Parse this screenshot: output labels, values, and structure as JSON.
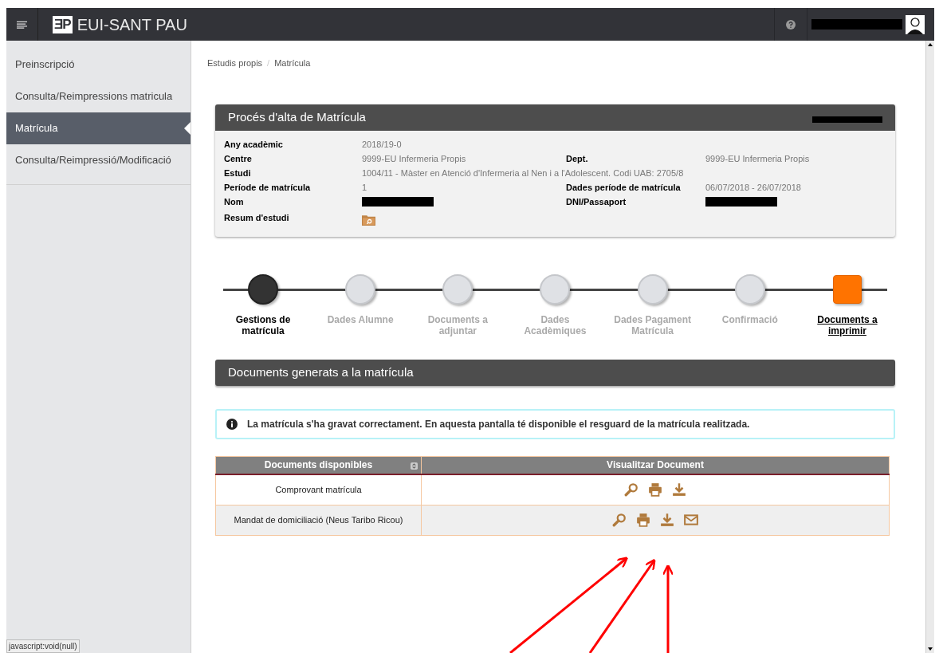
{
  "header": {
    "logo_mark": "ƎP",
    "logo_text": "EUI-SANT PAU"
  },
  "sidebar": {
    "items": [
      {
        "label": "Preinscripció",
        "selected": false
      },
      {
        "label": "Consulta/Reimpressions matricula",
        "selected": false
      },
      {
        "label": "Matrícula",
        "selected": true
      },
      {
        "label": "Consulta/Reimpressió/Modificació",
        "selected": false
      }
    ]
  },
  "breadcrumb": {
    "items": [
      "Estudis propis",
      "Matrícula"
    ],
    "separator": "/"
  },
  "enrolment_card": {
    "title": "Procés d'alta de Matrícula",
    "rows": [
      [
        {
          "label": "Any acadèmic",
          "kind": "text",
          "value": "2018/19-0"
        }
      ],
      [
        {
          "label": "Centre",
          "kind": "text",
          "value": "9999-EU Infermeria Propis"
        },
        {
          "label": "Dept.",
          "kind": "text",
          "value": "9999-EU Infermeria Propis"
        }
      ],
      [
        {
          "label": "Estudi",
          "kind": "text",
          "value": "1004/11 - Màster en Atenció d'Infermeria al Nen i a l'Adolescent. Codi UAB: 2705/8"
        }
      ],
      [
        {
          "label": "Període de matrícula",
          "kind": "text",
          "value": "1"
        },
        {
          "label": "Dades període de matrícula",
          "kind": "text",
          "value": "06/07/2018 - 26/07/2018"
        }
      ],
      [
        {
          "label": "Nom",
          "kind": "redacted"
        },
        {
          "label": "DNI/Passaport",
          "kind": "redacted"
        }
      ],
      [
        {
          "label": "Resum d'estudi",
          "kind": "folder"
        }
      ]
    ]
  },
  "steps": [
    {
      "label": "Gestions de matrícula",
      "kind": "done"
    },
    {
      "label": "Dades Alumne",
      "kind": "pending"
    },
    {
      "label": "Documents a adjuntar",
      "kind": "pending"
    },
    {
      "label": "Dades Acadèmiques",
      "kind": "pending"
    },
    {
      "label": "Dades Pagament Matrícula",
      "kind": "pending"
    },
    {
      "label": "Confirmació",
      "kind": "pending"
    },
    {
      "label": "Documents a imprimir",
      "kind": "current"
    }
  ],
  "documents_section": {
    "title": "Documents generats a la matrícula",
    "alert": "La matrícula s'ha gravat correctament. En aquesta pantalla té disponible el resguard de la matrícula realitzada.",
    "table": {
      "columns": [
        "Documents disponibles",
        "Visualitzar Document"
      ],
      "rows": [
        {
          "name": "Comprovant matrícula",
          "actions": [
            {
              "kind": "view"
            },
            {
              "kind": "print"
            },
            {
              "kind": "download"
            }
          ]
        },
        {
          "name": "Mandat de domiciliació (Neus Taribo Ricou)",
          "actions": [
            {
              "kind": "view"
            },
            {
              "kind": "print"
            },
            {
              "kind": "download"
            },
            {
              "kind": "email"
            }
          ]
        }
      ]
    }
  },
  "status_bar": "javascript:void(null)"
}
